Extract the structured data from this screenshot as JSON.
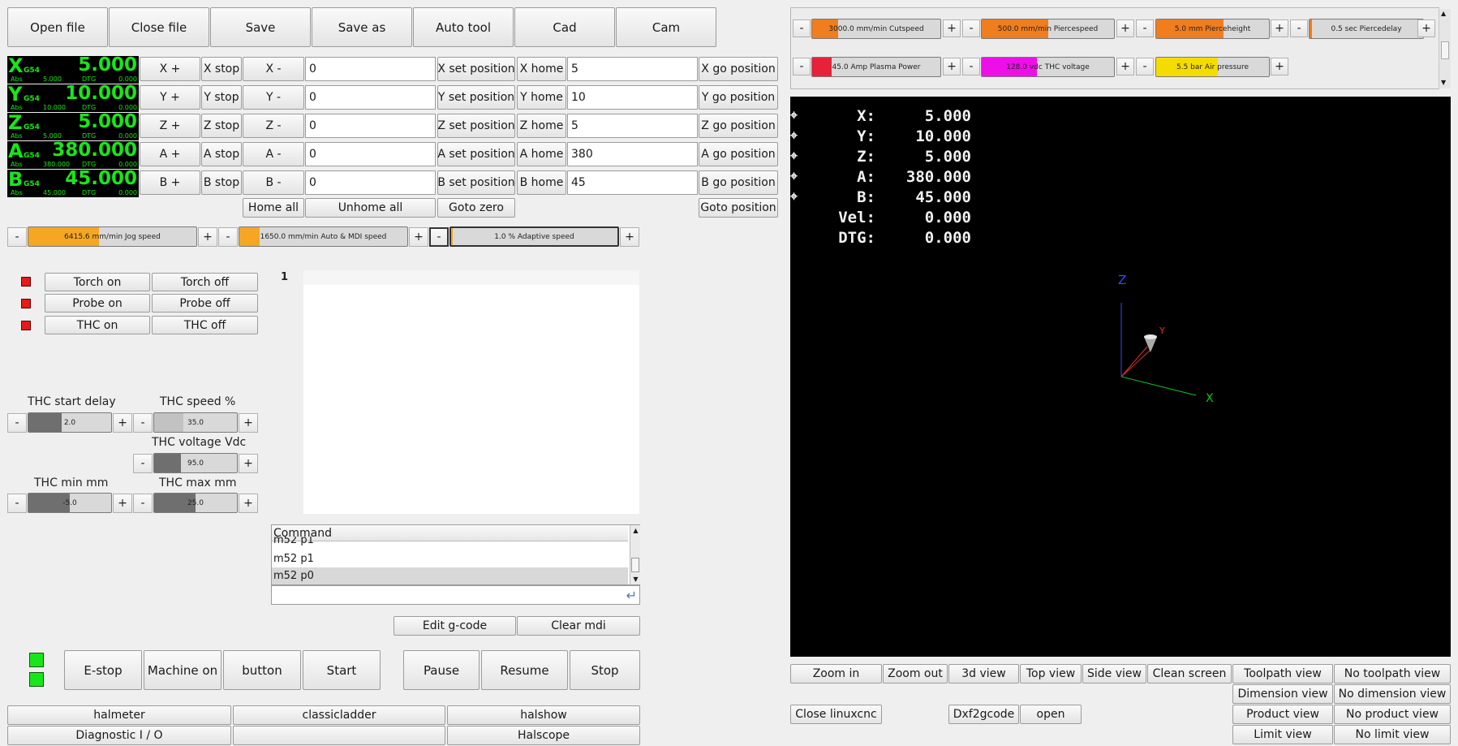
{
  "toolbar": {
    "open_file": "Open file",
    "close_file": "Close file",
    "save": "Save",
    "save_as": "Save as",
    "auto_tool": "Auto tool",
    "cad": "Cad",
    "cam": "Cam"
  },
  "dro": [
    {
      "axis": "X",
      "coord": "G54",
      "value": "5.000",
      "abs_label": "Abs",
      "abs": "5.000",
      "dtg_label": "DTG",
      "dtg": "0.000"
    },
    {
      "axis": "Y",
      "coord": "G54",
      "value": "10.000",
      "abs_label": "Abs",
      "abs": "10.000",
      "dtg_label": "DTG",
      "dtg": "0.000"
    },
    {
      "axis": "Z",
      "coord": "G54",
      "value": "5.000",
      "abs_label": "Abs",
      "abs": "5.000",
      "dtg_label": "DTG",
      "dtg": "0.000"
    },
    {
      "axis": "A",
      "coord": "G54",
      "value": "380.000",
      "abs_label": "Abs",
      "abs": "380.000",
      "dtg_label": "DTG",
      "dtg": "0.000"
    },
    {
      "axis": "B",
      "coord": "G54",
      "value": "45.000",
      "abs_label": "Abs",
      "abs": "45.000",
      "dtg_label": "DTG",
      "dtg": "0.000"
    }
  ],
  "jog_rows": [
    {
      "plus": "X +",
      "stop": "X stop",
      "minus": "X -",
      "offset": "0",
      "set": "X set position",
      "home": "X home",
      "home_val": "5",
      "go": "X go position"
    },
    {
      "plus": "Y +",
      "stop": "Y stop",
      "minus": "Y -",
      "offset": "0",
      "set": "Y set position",
      "home": "Y home",
      "home_val": "10",
      "go": "Y go position"
    },
    {
      "plus": "Z +",
      "stop": "Z stop",
      "minus": "Z -",
      "offset": "0",
      "set": "Z set position",
      "home": "Z home",
      "home_val": "5",
      "go": "Z go position"
    },
    {
      "plus": "A +",
      "stop": "A stop",
      "minus": "A -",
      "offset": "0",
      "set": "A set position",
      "home": "A home",
      "home_val": "380",
      "go": "A go position"
    },
    {
      "plus": "B +",
      "stop": "B stop",
      "minus": "B -",
      "offset": "0",
      "set": "B set position",
      "home": "B home",
      "home_val": "45",
      "go": "B go position"
    }
  ],
  "homing": {
    "home_all": "Home all",
    "unhome_all": "Unhome all",
    "goto_zero": "Goto zero",
    "goto_position": "Goto position"
  },
  "speed_sliders": [
    {
      "text": "6415.6 mm/min Jog speed",
      "fill": 0.42,
      "color": "#f5a623"
    },
    {
      "text": "1650.0 mm/min Auto & MDI speed",
      "fill": 0.12,
      "color": "#f5a623"
    },
    {
      "text": "1.0  % Adaptive speed",
      "fill": 0.01,
      "color": "#f5a623"
    }
  ],
  "plasma_sliders": [
    {
      "text": "3000.0 mm/min Cutspeed",
      "fill": 0.2,
      "color": "#f07d1e"
    },
    {
      "text": "500.0 mm/min Piercespeed",
      "fill": 0.5,
      "color": "#f07d1e"
    },
    {
      "text": "5.0 mm Pierceheight",
      "fill": 0.6,
      "color": "#f07d1e"
    },
    {
      "text": "0.5 sec Piercedelay",
      "fill": 0.02,
      "color": "#f07d1e"
    },
    {
      "text": "45.0 Amp Plasma Power",
      "fill": 0.15,
      "color": "#e8213a"
    },
    {
      "text": "128.0 vdc THC voltage",
      "fill": 0.42,
      "color": "#ee0ee8"
    },
    {
      "text": "5.5 bar Air pressure",
      "fill": 0.55,
      "color": "#f5dc00"
    }
  ],
  "io": [
    {
      "on": "Torch on",
      "off": "Torch off"
    },
    {
      "on": "Probe on",
      "off": "Probe off"
    },
    {
      "on": "THC on",
      "off": "THC off"
    }
  ],
  "thc": {
    "start_delay": {
      "label": "THC start delay",
      "text": "2.0",
      "fill": 0.4
    },
    "speed": {
      "label": "THC speed %",
      "text": "35.0",
      "fill": 0.35
    },
    "voltage": {
      "label": "THC voltage Vdc",
      "text": "95.0",
      "fill": 0.32
    },
    "min": {
      "label": "THC min mm",
      "text": "-5.0",
      "fill": 0.5
    },
    "max": {
      "label": "THC max mm",
      "text": "25.0",
      "fill": 0.5
    }
  },
  "gcode": {
    "line_number": "1"
  },
  "mdi": {
    "header": "Command",
    "history": [
      "m52 p1",
      "m52 p1",
      "m52 p0"
    ],
    "input": ""
  },
  "edit_gcode": "Edit g-code",
  "clear_mdi": "Clear mdi",
  "machine": {
    "estop": "E-stop",
    "machine_on": "Machine on",
    "button": "button",
    "start": "Start",
    "pause": "Pause",
    "resume": "Resume",
    "stop": "Stop"
  },
  "tools": {
    "halmeter": "halmeter",
    "classicladder": "classicladder",
    "halshow": "halshow",
    "diagnostic": "Diagnostic I / O",
    "blank": "",
    "halscope": "Halscope"
  },
  "viewport": {
    "rows": [
      {
        "label": "X:",
        "value": "5.000"
      },
      {
        "label": "Y:",
        "value": "10.000"
      },
      {
        "label": "Z:",
        "value": "5.000"
      },
      {
        "label": "A:",
        "value": "380.000"
      },
      {
        "label": "B:",
        "value": "45.000"
      },
      {
        "label": "Vel:",
        "value": "0.000"
      },
      {
        "label": "DTG:",
        "value": "0.000"
      }
    ],
    "axis_z": "Z",
    "axis_x": "X",
    "axis_y": "Y"
  },
  "view_buttons": {
    "zoom_in": "Zoom in",
    "zoom_out": "Zoom out",
    "view_3d": "3d view",
    "top_view": "Top view",
    "side_view": "Side view",
    "clean_screen": "Clean screen",
    "toolpath_view": "Toolpath view",
    "no_toolpath_view": "No toolpath view",
    "dimension_view": "Dimension view",
    "no_dimension_view": "No dimension view",
    "close_linuxcnc": "Close linuxcnc",
    "dxf2gcode": "Dxf2gcode",
    "open": "open",
    "product_view": "Product view",
    "no_product_view": "No product view",
    "limit_view": "Limit view",
    "no_limit_view": "No limit view"
  }
}
